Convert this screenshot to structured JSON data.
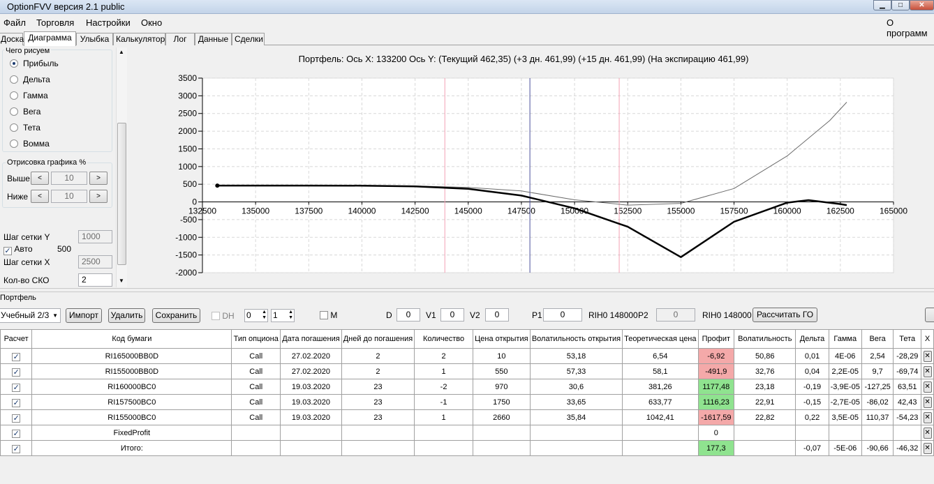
{
  "window": {
    "title": "OptionFVV версия 2.1 public",
    "min": "▁",
    "max": "□",
    "close": "✕"
  },
  "menu": {
    "file": "Файл",
    "trading": "Торговля",
    "settings": "Настройки",
    "window": "Окно",
    "about": "О программ"
  },
  "tabs": [
    "Доска",
    "Диаграмма",
    "Улыбка",
    "Калькулятор",
    "Лог",
    "Данные",
    "Сделки"
  ],
  "left": {
    "group_title": "Чего рисуем",
    "radios": [
      "Прибыль",
      "Дельта",
      "Гамма",
      "Вега",
      "Тета",
      "Вомма"
    ],
    "draw_title": "Отрисовка графика %",
    "above_label": "Выше",
    "above_value": "10",
    "below_label": "Ниже",
    "below_value": "10",
    "btn_left": "<",
    "btn_right": ">",
    "grid_y_label": "Шаг сетки Y",
    "grid_y_value": "1000",
    "auto_label": "Авто",
    "auto_value": "500",
    "grid_x_label": "Шаг сетки X",
    "grid_x_value": "2500",
    "sko_label": "Кол-во СКО",
    "sko_value": "2"
  },
  "chart_title": "Портфель: Ось X: 133200 Ось Y:  (Текущий 462,35)  (+3 дн. 461,99)  (+15 дн. 461,99)  (На экспирацию 461,99)",
  "chart_data": {
    "type": "line",
    "xlim": [
      132500,
      165000
    ],
    "ylim": [
      -2000,
      3500
    ],
    "x_ticks": [
      132500,
      135000,
      137500,
      140000,
      142500,
      145000,
      147500,
      150000,
      152500,
      155000,
      157500,
      160000,
      162500,
      165000
    ],
    "y_ticks": [
      3500,
      3000,
      2500,
      2000,
      1500,
      1000,
      500,
      0,
      -500,
      -1000,
      -1500,
      -2000
    ],
    "vlines": [
      {
        "x": 143900,
        "color": "#f4a0b4"
      },
      {
        "x": 147900,
        "color": "#4a4f9a"
      },
      {
        "x": 152100,
        "color": "#f4a0b4"
      }
    ],
    "current_point": {
      "x": 133200,
      "y": 462
    },
    "series": [
      {
        "color": "#6a6a6a",
        "width": 1,
        "x": [
          133200,
          135000,
          137500,
          140000,
          142500,
          145000,
          147500,
          150000,
          152500,
          155000,
          157500,
          160000,
          162000,
          162800
        ],
        "y": [
          462,
          462,
          462,
          460,
          450,
          410,
          310,
          60,
          -90,
          -40,
          380,
          1300,
          2300,
          2820
        ]
      },
      {
        "color": "#000000",
        "width": 2.5,
        "x": [
          133200,
          135000,
          137500,
          140000,
          142500,
          145000,
          147500,
          150000,
          152500,
          155000,
          157500,
          160000,
          161000,
          162500,
          162800
        ],
        "y": [
          462,
          462,
          462,
          460,
          440,
          370,
          180,
          -180,
          -700,
          -1560,
          -560,
          -20,
          50,
          -60,
          -90
        ]
      }
    ]
  },
  "portfolio": {
    "label": "Портфель",
    "select": "Учебный 2/3",
    "import": "Импорт",
    "delete": "Удалить",
    "save": "Сохранить",
    "dh": "DH",
    "spin1": "0",
    "spin2": "1",
    "m": "M",
    "d_label": "D",
    "d_value": "0",
    "v1_label": "V1",
    "v1_value": "0",
    "v2_label": "V2",
    "v2_value": "0",
    "p1_label": "P1",
    "p1_value": "0",
    "p1_sec": "RIH0 148000",
    "p2_label": "P2",
    "p2_value": "0",
    "p2_sec": "RIH0 148000",
    "calc_go": "Рассчитать ГО"
  },
  "table": {
    "headers": [
      "Расчет",
      "Код бумаги",
      "Тип опциона",
      "Дата погашения",
      "Дней до погашения",
      "Количество",
      "Цена открытия",
      "Волатильность открытия",
      "Теоретическая цена",
      "Профит",
      "Волатильность",
      "Дельта",
      "Гамма",
      "Вега",
      "Тета",
      "X"
    ],
    "rows": [
      [
        "RI165000BB0D",
        "Call",
        "27.02.2020",
        "2",
        "2",
        "10",
        "53,18",
        "6,54",
        "-6,92",
        "50,86",
        "0,01",
        "4E-06",
        "2,54",
        "-28,29"
      ],
      [
        "RI155000BB0D",
        "Call",
        "27.02.2020",
        "2",
        "1",
        "550",
        "57,33",
        "58,1",
        "-491,9",
        "32,76",
        "0,04",
        "2,2E-05",
        "9,7",
        "-69,74"
      ],
      [
        "RI160000BC0",
        "Call",
        "19.03.2020",
        "23",
        "-2",
        "970",
        "30,6",
        "381,26",
        "1177,48",
        "23,18",
        "-0,19",
        "-3,9E-05",
        "-127,25",
        "63,51"
      ],
      [
        "RI157500BC0",
        "Call",
        "19.03.2020",
        "23",
        "-1",
        "1750",
        "33,65",
        "633,77",
        "1116,23",
        "22,91",
        "-0,15",
        "-2,7E-05",
        "-86,02",
        "42,43"
      ],
      [
        "RI155000BC0",
        "Call",
        "19.03.2020",
        "23",
        "1",
        "2660",
        "35,84",
        "1042,41",
        "-1617,59",
        "22,82",
        "0,22",
        "3,5E-05",
        "110,37",
        "-54,23"
      ],
      [
        "FixedProfit",
        "",
        "",
        "",
        "",
        "",
        "",
        "",
        "0",
        "",
        "",
        "",
        "",
        ""
      ],
      [
        "Итого:",
        "",
        "",
        "",
        "",
        "",
        "",
        "",
        "177,3",
        "",
        "-0,07",
        "-5E-06",
        "-90,66",
        "-46,32"
      ]
    ],
    "profit_state": [
      "neg",
      "neg",
      "pos",
      "pos",
      "neg",
      "",
      "pos"
    ]
  }
}
